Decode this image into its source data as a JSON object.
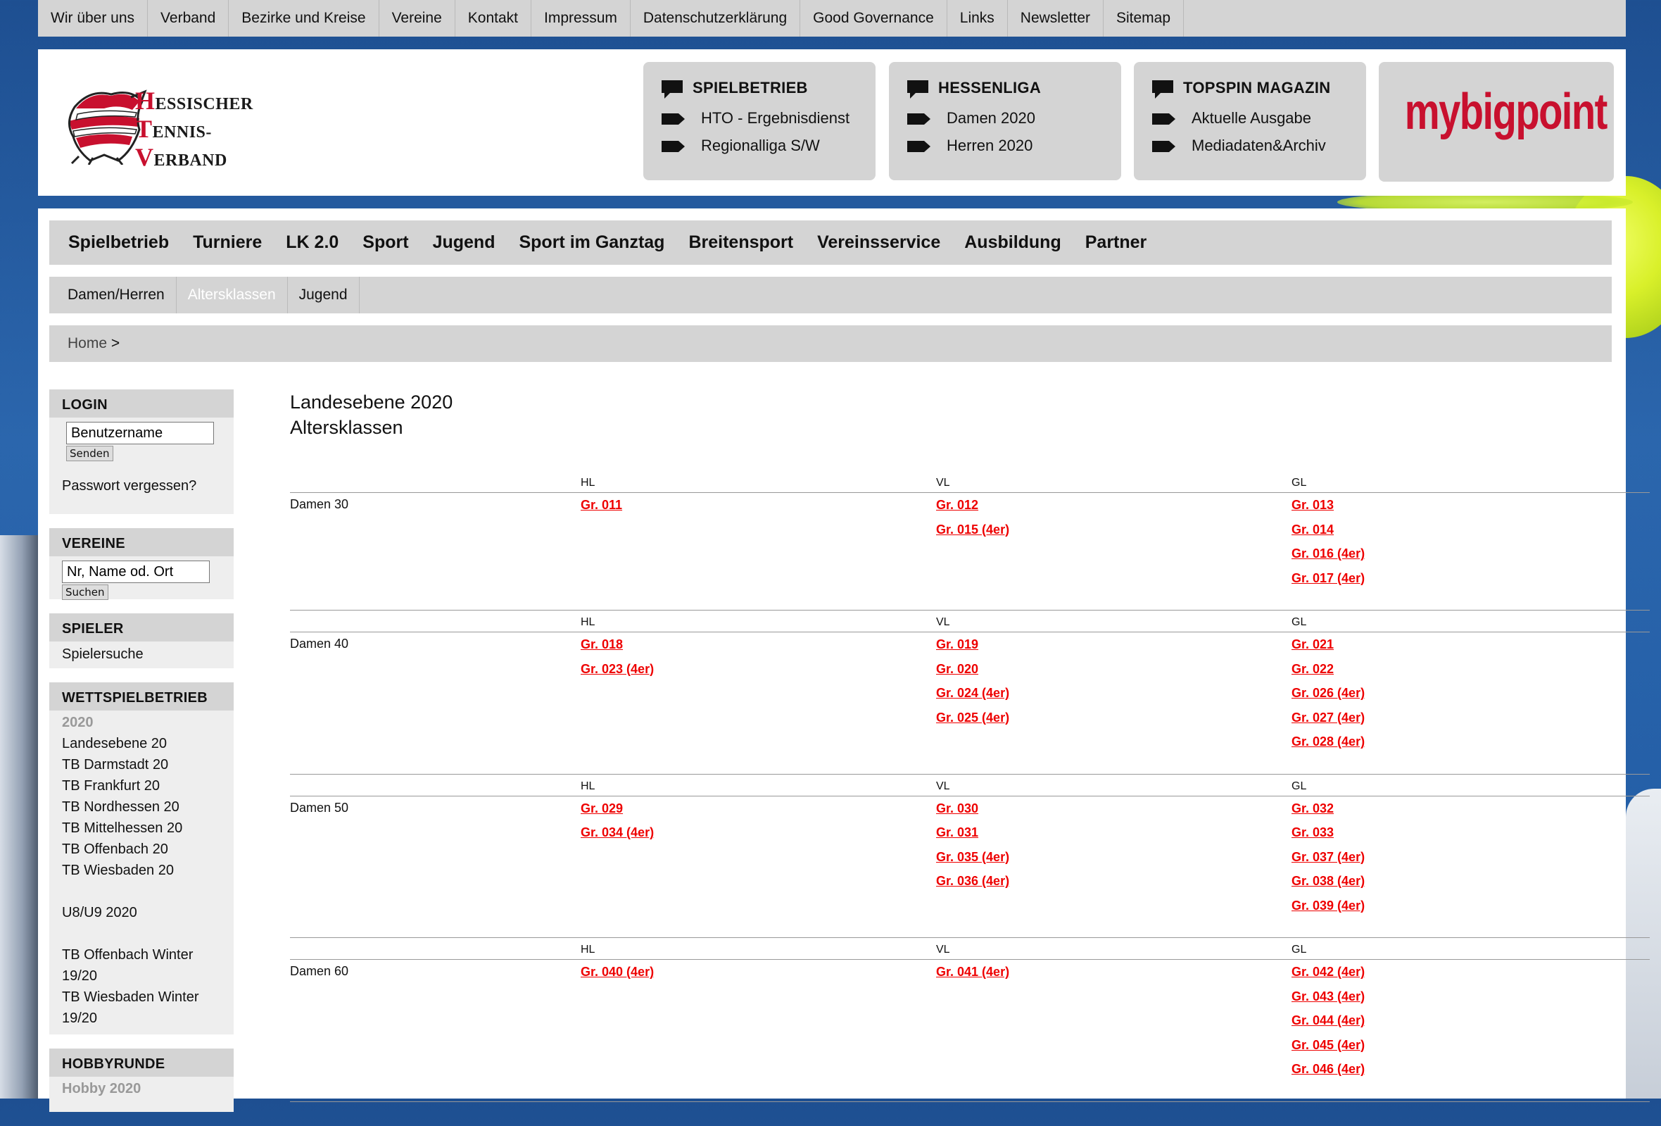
{
  "topnav": [
    "Wir über uns",
    "Verband",
    "Bezirke und Kreise",
    "Vereine",
    "Kontakt",
    "Impressum",
    "Datenschutzerklärung",
    "Good Governance",
    "Links",
    "Newsletter",
    "Sitemap"
  ],
  "logo": {
    "line1_big": "H",
    "line1": "ESSISCHER",
    "line2_big": "T",
    "line2": "ENNIS-",
    "line3_big": "V",
    "line3": "ERBAND",
    "colors": {
      "red": "#c8102e"
    }
  },
  "header_boxes": [
    {
      "title": "SPIELBETRIEB",
      "links": [
        "HTO - Ergebnisdienst",
        "Regionalliga S/W"
      ]
    },
    {
      "title": "HESSENLIGA",
      "links": [
        "Damen 2020",
        "Herren 2020"
      ]
    },
    {
      "title": "TOPSPIN MAGAZIN",
      "links": [
        "Aktuelle Ausgabe",
        "Mediadaten&Archiv"
      ]
    }
  ],
  "sponsor": "mybigpoint",
  "mainnav": [
    "Spielbetrieb",
    "Turniere",
    "LK 2.0",
    "Sport",
    "Jugend",
    "Sport im Ganztag",
    "Breitensport",
    "Vereinsservice",
    "Ausbildung",
    "Partner"
  ],
  "subnav": [
    "Damen/Herren",
    "Altersklassen",
    "Jugend"
  ],
  "subnav_active": "Altersklassen",
  "breadcrumb": {
    "home": "Home",
    "sep": ">"
  },
  "sidebar": {
    "login": {
      "title": "LOGIN",
      "placeholder": "Benutzername",
      "button": "Senden",
      "forgot": "Passwort vergessen?"
    },
    "vereine": {
      "title": "VEREINE",
      "placeholder": "Nr, Name od. Ort",
      "button": "Suchen"
    },
    "spieler": {
      "title": "SPIELER",
      "link": "Spielersuche"
    },
    "wettspiel": {
      "title": "WETTSPIELBETRIEB",
      "year": "2020",
      "links": [
        "Landesebene 20",
        "TB Darmstadt 20",
        "TB Frankfurt 20",
        "TB Nordhessen 20",
        "TB Mittelhessen 20",
        "TB Offenbach 20",
        "TB Wiesbaden 20"
      ],
      "u8": "U8/U9 2020",
      "winter": [
        "TB Offenbach Winter",
        "19/20",
        "TB Wiesbaden Winter",
        "19/20"
      ]
    },
    "hobby": {
      "title": "HOBBYRUNDE",
      "year": "Hobby 2020"
    }
  },
  "content": {
    "title1": "Landesebene 2020",
    "title2": "Altersklassen",
    "col_headers": [
      "HL",
      "VL",
      "GL"
    ],
    "groups": [
      {
        "name": "Damen 30",
        "hl": [
          "Gr. 011"
        ],
        "vl": [
          "Gr. 012",
          "Gr. 015 (4er)"
        ],
        "gl": [
          "Gr. 013",
          "Gr. 014",
          "Gr. 016 (4er)",
          "Gr. 017 (4er)"
        ]
      },
      {
        "name": "Damen 40",
        "hl": [
          "Gr. 018",
          "Gr. 023 (4er)"
        ],
        "vl": [
          "Gr. 019",
          "Gr. 020",
          "Gr. 024 (4er)",
          "Gr. 025 (4er)"
        ],
        "gl": [
          "Gr. 021",
          "Gr. 022",
          "Gr. 026 (4er)",
          "Gr. 027 (4er)",
          "Gr. 028 (4er)"
        ]
      },
      {
        "name": "Damen 50",
        "hl": [
          "Gr. 029",
          "Gr. 034 (4er)"
        ],
        "vl": [
          "Gr. 030",
          "Gr. 031",
          "Gr. 035 (4er)",
          "Gr. 036 (4er)"
        ],
        "gl": [
          "Gr. 032",
          "Gr. 033",
          "Gr. 037 (4er)",
          "Gr. 038 (4er)",
          "Gr. 039 (4er)"
        ]
      },
      {
        "name": "Damen 60",
        "hl": [
          "Gr. 040 (4er)"
        ],
        "vl": [
          "Gr. 041 (4er)"
        ],
        "gl": [
          "Gr. 042 (4er)",
          "Gr. 043 (4er)",
          "Gr. 044 (4er)",
          "Gr. 045 (4er)",
          "Gr. 046 (4er)"
        ]
      }
    ]
  }
}
